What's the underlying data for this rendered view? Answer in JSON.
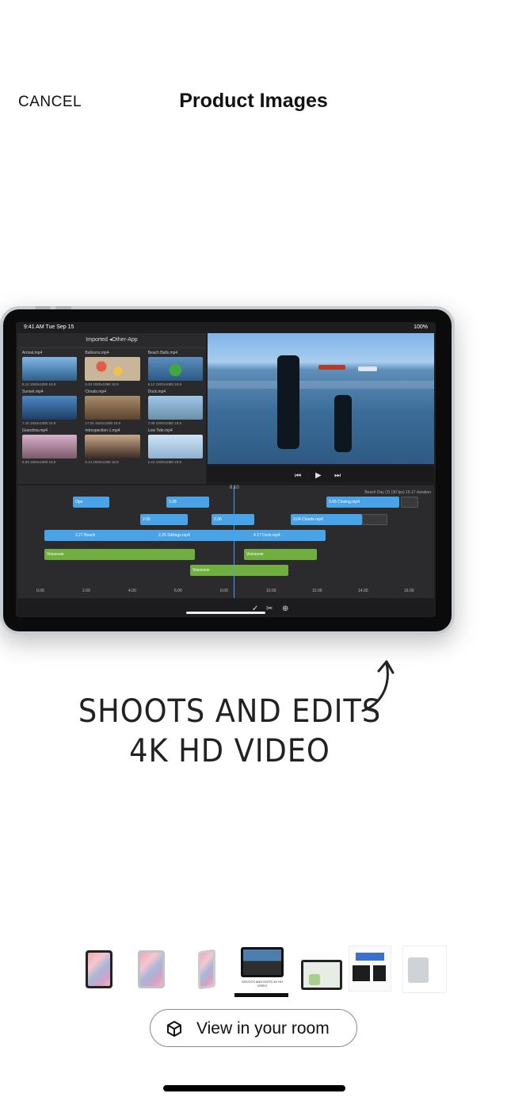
{
  "header": {
    "cancel_label": "CANCEL",
    "title": "Product Images"
  },
  "device_screen": {
    "status_time": "9:41 AM  Tue Sep 15",
    "status_battery": "100%",
    "media_header": "Imported ◂Other-App",
    "media_items": [
      {
        "name": "Arrival.mp4",
        "meta": "5.12  1920x1080  16:9"
      },
      {
        "name": "Balloons.mp4",
        "meta": "9.20  1920x1080  16:9"
      },
      {
        "name": "Beach Balls.mp4",
        "meta": "5.12  1920x1080  16:9"
      },
      {
        "name": "Sunset.mp4",
        "meta": "7.10  1920x1080  16:9"
      },
      {
        "name": "Clouds.mp4",
        "meta": "17.00  1920x1080  16:9"
      },
      {
        "name": "Dock.mp4",
        "meta": "7.09  1920x1080  16:9"
      },
      {
        "name": "Grandma.mp4",
        "meta": "6.09  1920x1080  16:9"
      },
      {
        "name": "Introspection-1.mp4",
        "meta": "6.14  1920x1080  16:9"
      },
      {
        "name": "Low Tide.mp4",
        "meta": "2.22  1920x1080  16:9"
      }
    ],
    "timeline_time": "8.10",
    "clip_info": "Beach Day (2) (30 fps)  15.17 duration",
    "clips": {
      "c1": "Ope",
      "c2": "3.28",
      "c3": "0.05  Closing.mp4",
      "c4": "2.06",
      "c5": "3.04  Clouds.mp4",
      "c6": "2.27  Beach",
      "c7": "2.25  Siblings.mp4",
      "c8": "4.17  Dock.mp4",
      "c9": "Voiceover",
      "c10": "Voiceover",
      "c11": "Voiceover"
    },
    "ruler_ticks": [
      "0.00",
      "2.00",
      "4.00",
      "6.00",
      "8.00",
      "10.00",
      "12.00",
      "14.00",
      "16.00"
    ]
  },
  "caption": {
    "line1": "SHOOTS AND EDITS",
    "line2": "4K HD VIDEO"
  },
  "thumbnail_small_text": "SHOOTS AND EDITS 4K HD VIDEO",
  "room_button": {
    "label": "View in your room"
  }
}
